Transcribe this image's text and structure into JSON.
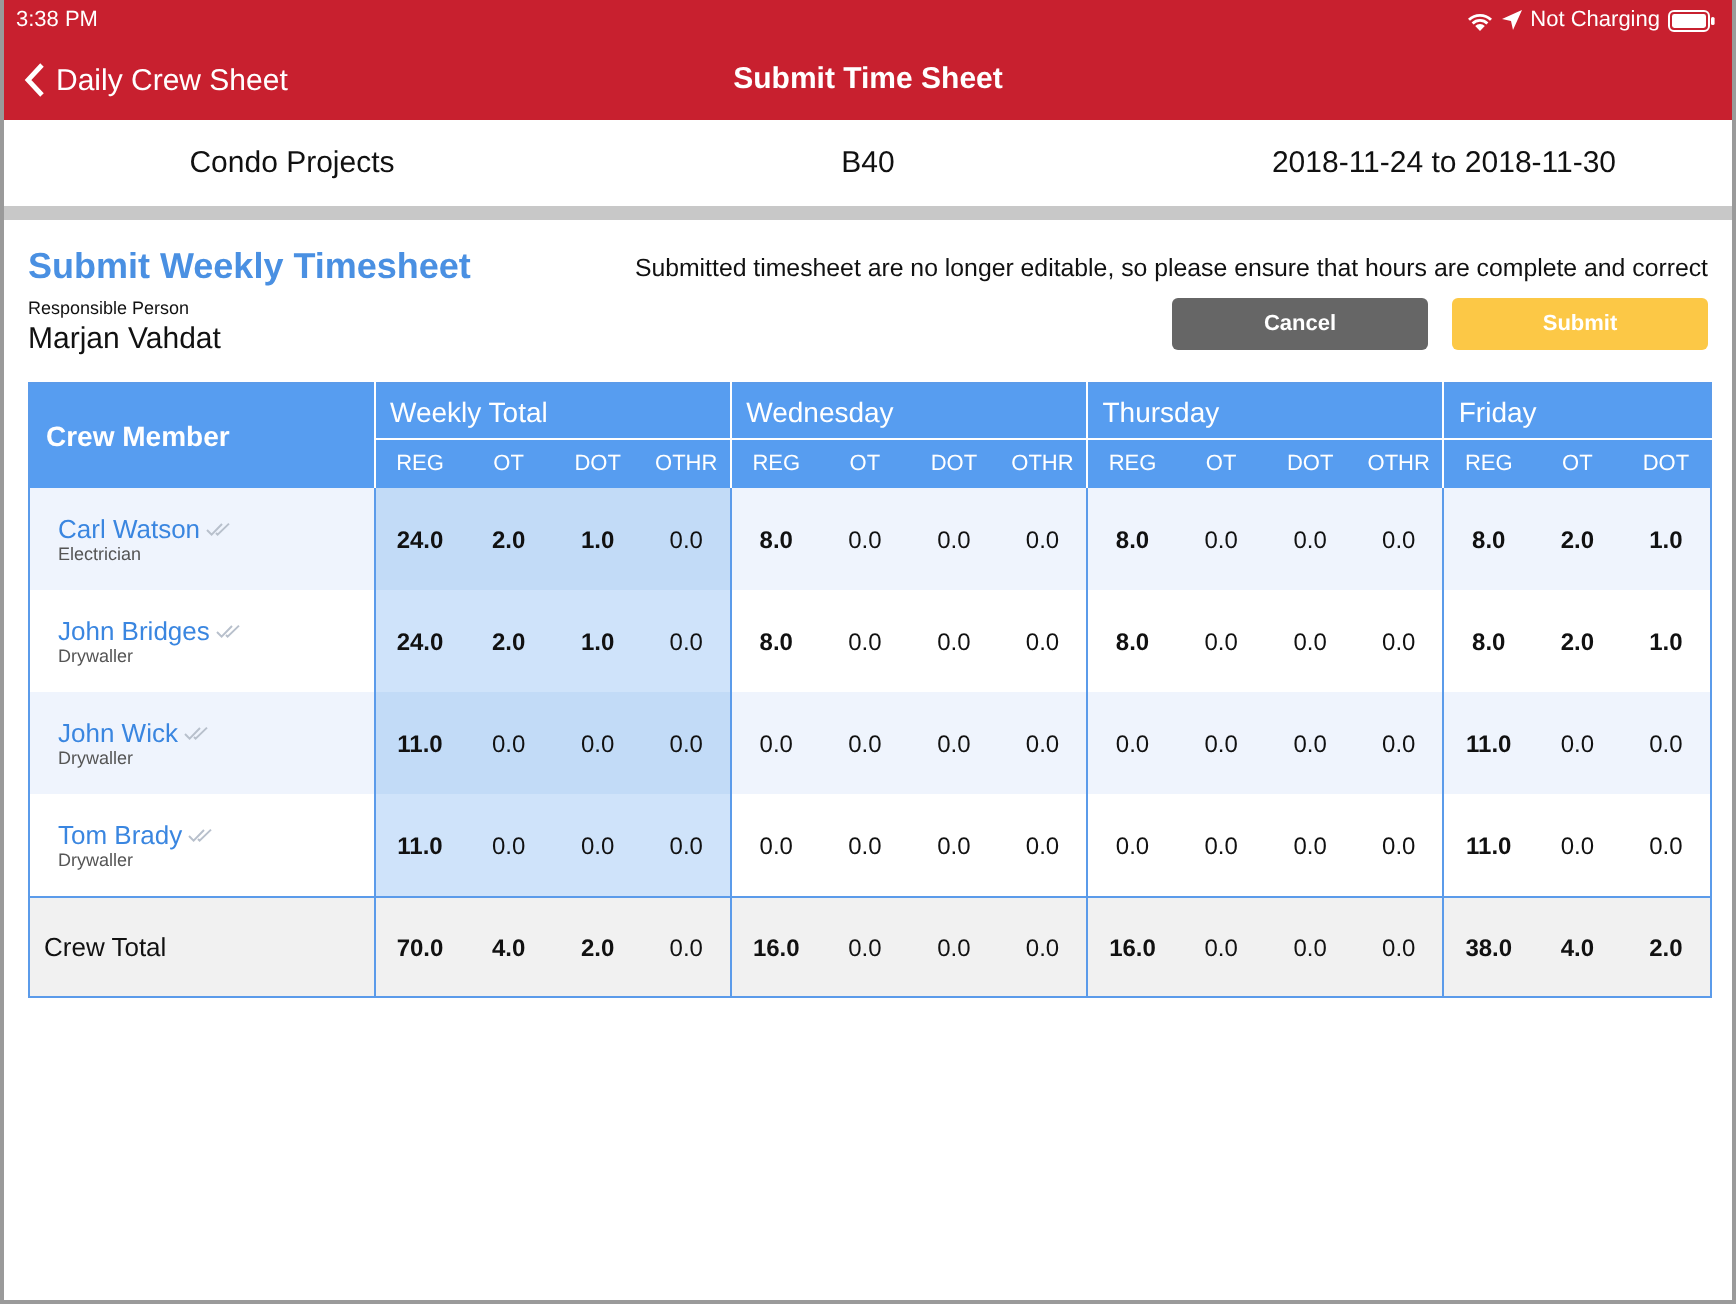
{
  "status_bar": {
    "time": "3:38 PM",
    "battery_text": "Not Charging"
  },
  "nav": {
    "back": "Daily Crew Sheet",
    "title": "Submit Time Sheet"
  },
  "info": {
    "project": "Condo Projects",
    "code": "B40",
    "period": "2018-11-24 to 2018-11-30"
  },
  "heading": "Submit Weekly Timesheet",
  "notice": "Submitted timesheet are no longer editable, so please ensure that hours are complete and correct",
  "responsible": {
    "label": "Responsible Person",
    "name": "Marjan Vahdat"
  },
  "buttons": [
    {
      "label": "Cancel",
      "kind": "cancel"
    },
    {
      "label": "Submit",
      "kind": "submit"
    }
  ],
  "table": {
    "first_column": "Crew Member",
    "groups": [
      {
        "title": "Weekly Total",
        "highlight": true,
        "columns": [
          "REG",
          "OT",
          "DOT",
          "OTHR"
        ]
      },
      {
        "title": "Wednesday",
        "highlight": false,
        "columns": [
          "REG",
          "OT",
          "DOT",
          "OTHR"
        ]
      },
      {
        "title": "Thursday",
        "highlight": false,
        "columns": [
          "REG",
          "OT",
          "DOT",
          "OTHR"
        ]
      },
      {
        "title": "Friday",
        "highlight": false,
        "columns": [
          "REG",
          "OT",
          "DOT"
        ]
      }
    ],
    "rows": [
      {
        "name": "Carl Watson",
        "role": "Electrician",
        "cells": [
          {
            "value": "24.0",
            "bold": true
          },
          {
            "value": "2.0",
            "bold": true
          },
          {
            "value": "1.0",
            "bold": true
          },
          {
            "value": "0.0",
            "bold": false
          },
          {
            "value": "8.0",
            "bold": true
          },
          {
            "value": "0.0",
            "bold": false
          },
          {
            "value": "0.0",
            "bold": false
          },
          {
            "value": "0.0",
            "bold": false
          },
          {
            "value": "8.0",
            "bold": true
          },
          {
            "value": "0.0",
            "bold": false
          },
          {
            "value": "0.0",
            "bold": false
          },
          {
            "value": "0.0",
            "bold": false
          },
          {
            "value": "8.0",
            "bold": true
          },
          {
            "value": "2.0",
            "bold": true
          },
          {
            "value": "1.0",
            "bold": true
          }
        ]
      },
      {
        "name": "John Bridges",
        "role": "Drywaller",
        "cells": [
          {
            "value": "24.0",
            "bold": true
          },
          {
            "value": "2.0",
            "bold": true
          },
          {
            "value": "1.0",
            "bold": true
          },
          {
            "value": "0.0",
            "bold": false
          },
          {
            "value": "8.0",
            "bold": true
          },
          {
            "value": "0.0",
            "bold": false
          },
          {
            "value": "0.0",
            "bold": false
          },
          {
            "value": "0.0",
            "bold": false
          },
          {
            "value": "8.0",
            "bold": true
          },
          {
            "value": "0.0",
            "bold": false
          },
          {
            "value": "0.0",
            "bold": false
          },
          {
            "value": "0.0",
            "bold": false
          },
          {
            "value": "8.0",
            "bold": true
          },
          {
            "value": "2.0",
            "bold": true
          },
          {
            "value": "1.0",
            "bold": true
          }
        ]
      },
      {
        "name": "John Wick",
        "role": "Drywaller",
        "cells": [
          {
            "value": "11.0",
            "bold": true
          },
          {
            "value": "0.0",
            "bold": false
          },
          {
            "value": "0.0",
            "bold": false
          },
          {
            "value": "0.0",
            "bold": false
          },
          {
            "value": "0.0",
            "bold": false
          },
          {
            "value": "0.0",
            "bold": false
          },
          {
            "value": "0.0",
            "bold": false
          },
          {
            "value": "0.0",
            "bold": false
          },
          {
            "value": "0.0",
            "bold": false
          },
          {
            "value": "0.0",
            "bold": false
          },
          {
            "value": "0.0",
            "bold": false
          },
          {
            "value": "0.0",
            "bold": false
          },
          {
            "value": "11.0",
            "bold": true
          },
          {
            "value": "0.0",
            "bold": false
          },
          {
            "value": "0.0",
            "bold": false
          }
        ]
      },
      {
        "name": "Tom Brady",
        "role": "Drywaller",
        "cells": [
          {
            "value": "11.0",
            "bold": true
          },
          {
            "value": "0.0",
            "bold": false
          },
          {
            "value": "0.0",
            "bold": false
          },
          {
            "value": "0.0",
            "bold": false
          },
          {
            "value": "0.0",
            "bold": false
          },
          {
            "value": "0.0",
            "bold": false
          },
          {
            "value": "0.0",
            "bold": false
          },
          {
            "value": "0.0",
            "bold": false
          },
          {
            "value": "0.0",
            "bold": false
          },
          {
            "value": "0.0",
            "bold": false
          },
          {
            "value": "0.0",
            "bold": false
          },
          {
            "value": "0.0",
            "bold": false
          },
          {
            "value": "11.0",
            "bold": true
          },
          {
            "value": "0.0",
            "bold": false
          },
          {
            "value": "0.0",
            "bold": false
          }
        ]
      }
    ],
    "total": {
      "label": "Crew Total",
      "cells": [
        {
          "value": "70.0",
          "bold": true
        },
        {
          "value": "4.0",
          "bold": true
        },
        {
          "value": "2.0",
          "bold": true
        },
        {
          "value": "0.0",
          "bold": false
        },
        {
          "value": "16.0",
          "bold": true
        },
        {
          "value": "0.0",
          "bold": false
        },
        {
          "value": "0.0",
          "bold": false
        },
        {
          "value": "0.0",
          "bold": false
        },
        {
          "value": "16.0",
          "bold": true
        },
        {
          "value": "0.0",
          "bold": false
        },
        {
          "value": "0.0",
          "bold": false
        },
        {
          "value": "0.0",
          "bold": false
        },
        {
          "value": "38.0",
          "bold": true
        },
        {
          "value": "4.0",
          "bold": true
        },
        {
          "value": "2.0",
          "bold": true
        }
      ]
    }
  }
}
